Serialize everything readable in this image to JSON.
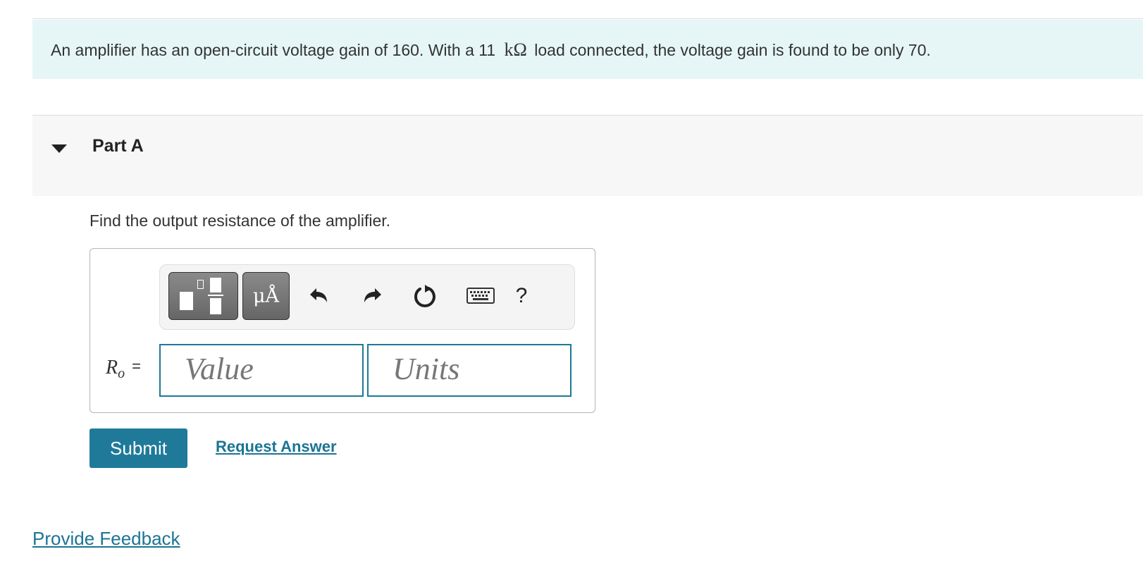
{
  "problem": {
    "text_before": "An amplifier has an open-circuit voltage gain of 160. With a 11",
    "unit": "kΩ",
    "text_after": "load connected, the voltage gain is found to be only 70."
  },
  "part": {
    "title": "Part A",
    "question": "Find the output resistance of the amplifier."
  },
  "toolbar": {
    "templates_icon": "templates-icon",
    "units_label": "μÅ",
    "undo_icon": "undo-icon",
    "redo_icon": "redo-icon",
    "reset_icon": "reset-icon",
    "keyboard_icon": "keyboard-icon",
    "help_label": "?"
  },
  "answer": {
    "variable": "R",
    "subscript": "o",
    "equals": "=",
    "value_placeholder": "Value",
    "units_placeholder": "Units"
  },
  "actions": {
    "submit_label": "Submit",
    "request_answer_label": "Request Answer"
  },
  "footer": {
    "feedback_label": "Provide Feedback"
  },
  "colors": {
    "problem_background": "#e6f6f6",
    "part_background": "#f7f7f7",
    "accent": "#1f7a9a",
    "field_border": "#1d7a93"
  }
}
